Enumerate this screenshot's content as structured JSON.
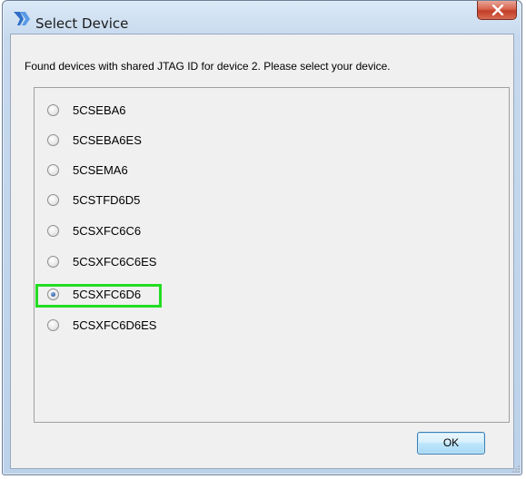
{
  "window": {
    "title": "Select Device",
    "close_glyph": "X"
  },
  "dialog": {
    "instruction": "Found devices with shared JTAG ID for device 2. Please select your device.",
    "devices": [
      {
        "label": "5CSEBA6",
        "selected": false
      },
      {
        "label": "5CSEBA6ES",
        "selected": false
      },
      {
        "label": "5CSEMA6",
        "selected": false
      },
      {
        "label": "5CSTFD6D5",
        "selected": false
      },
      {
        "label": "5CSXFC6C6",
        "selected": false
      },
      {
        "label": "5CSXFC6C6ES",
        "selected": false
      },
      {
        "label": "5CSXFC6D6",
        "selected": true
      },
      {
        "label": "5CSXFC6D6ES",
        "selected": false
      }
    ],
    "ok_label": "OK"
  },
  "colors": {
    "highlight": "#22dd22",
    "title_bar": "#c6d9ee",
    "close_button": "#c13e28"
  }
}
